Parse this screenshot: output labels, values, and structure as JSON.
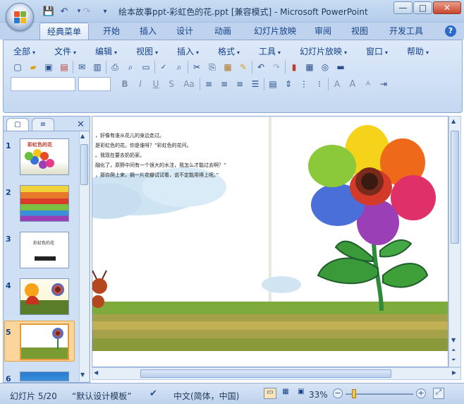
{
  "window": {
    "title": "绘本故事ppt-彩虹色的花.ppt [兼容模式] - Microsoft PowerPoint",
    "controls": {
      "minimize": "—",
      "maximize": "□",
      "close": "✕"
    }
  },
  "quick_access": {
    "save": "💾",
    "undo": "↶",
    "redo": "↷",
    "customize": "▾"
  },
  "ribbon_tabs": [
    "经典菜单",
    "开始",
    "插入",
    "设计",
    "动画",
    "幻灯片放映",
    "审阅",
    "视图",
    "开发工具"
  ],
  "help_icon": "?",
  "classic_menu": [
    "全部",
    "文件",
    "编辑",
    "视图",
    "插入",
    "格式",
    "工具",
    "幻灯片放映",
    "窗口",
    "帮助"
  ],
  "format_buttons": {
    "bold": "B",
    "italic": "I",
    "underline": "U",
    "strike": "S",
    "case": "Aa"
  },
  "font_size_buttons": {
    "a1": "A",
    "a2": "A",
    "a3": "A"
  },
  "panel_tabs": {
    "slides": "▢",
    "outline": "≡",
    "close": "✕"
  },
  "thumbnails": [
    {
      "num": "1",
      "title": "彩虹色的花"
    },
    {
      "num": "2",
      "title": ""
    },
    {
      "num": "3",
      "title": "彩虹色的花"
    },
    {
      "num": "4",
      "title": ""
    },
    {
      "num": "5",
      "title": ""
    },
    {
      "num": "6",
      "title": ""
    }
  ],
  "slide_text": [
    "，好像有谁从花儿的身边走过。",
    "是彩虹色的花。你是谁呀？”彩虹色的花问。",
    "。我现在要去奶奶家。",
    "融化了，原野中间有一个很大的水洼，我怎么才能过去啊？”",
    "，那你爬上来，摘一片花瓣试试看，说不定能用得上呢。”"
  ],
  "status": {
    "slide": "幻灯片 5/20",
    "theme": "“默认设计模板”",
    "language": "中文(简体，中国)",
    "zoom": "33%",
    "zoom_level": 0.33
  },
  "colors": {
    "accent": "#15428b",
    "ribbon_bg": "#cfe0f5",
    "selected_thumb": "#fbd69c"
  }
}
